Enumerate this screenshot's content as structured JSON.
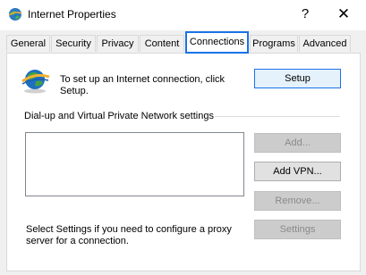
{
  "window": {
    "title": "Internet Properties",
    "icons": {
      "app": "internet-globe-icon",
      "help": "question-mark",
      "close": "x-close"
    },
    "help_glyph": "?",
    "close_glyph": "✕"
  },
  "tabs": [
    {
      "label": "General",
      "active": false
    },
    {
      "label": "Security",
      "active": false
    },
    {
      "label": "Privacy",
      "active": false
    },
    {
      "label": "Content",
      "active": false
    },
    {
      "label": "Connections",
      "active": true
    },
    {
      "label": "Programs",
      "active": false
    },
    {
      "label": "Advanced",
      "active": false
    }
  ],
  "setup": {
    "text": "To set up an Internet connection, click Setup.",
    "button_label": "Setup"
  },
  "dialup": {
    "group_label": "Dial-up and Virtual Private Network settings",
    "add_label": "Add...",
    "add_vpn_label": "Add VPN...",
    "remove_label": "Remove...",
    "settings_label": "Settings"
  },
  "proxy": {
    "text": "Select Settings if you need to configure a proxy server for a connection."
  },
  "colors": {
    "accent": "#1a73e8",
    "disabled_button": "#cccccc"
  }
}
